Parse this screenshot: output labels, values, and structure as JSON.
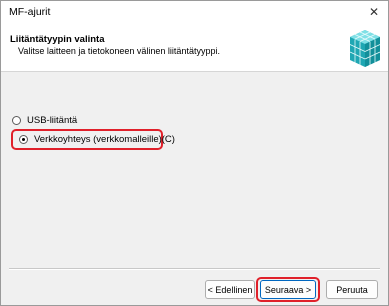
{
  "window": {
    "title": "MF-ajurit",
    "close_glyph": "✕"
  },
  "header": {
    "title": "Liitäntätyypin valinta",
    "subtitle": "Valitse laitteen ja tietokoneen välinen liitäntätyyppi.",
    "icon": "network-cubes-icon"
  },
  "options": [
    {
      "label": "USB-liitäntä",
      "selected": false
    },
    {
      "label": "Verkkoyhteys (verkkomalleille)(C)",
      "selected": true
    }
  ],
  "buttons": {
    "back": "< Edellinen",
    "next": "Seuraava >",
    "cancel": "Peruuta"
  },
  "colors": {
    "highlight": "#e0202a",
    "accent": "#0067c0"
  }
}
